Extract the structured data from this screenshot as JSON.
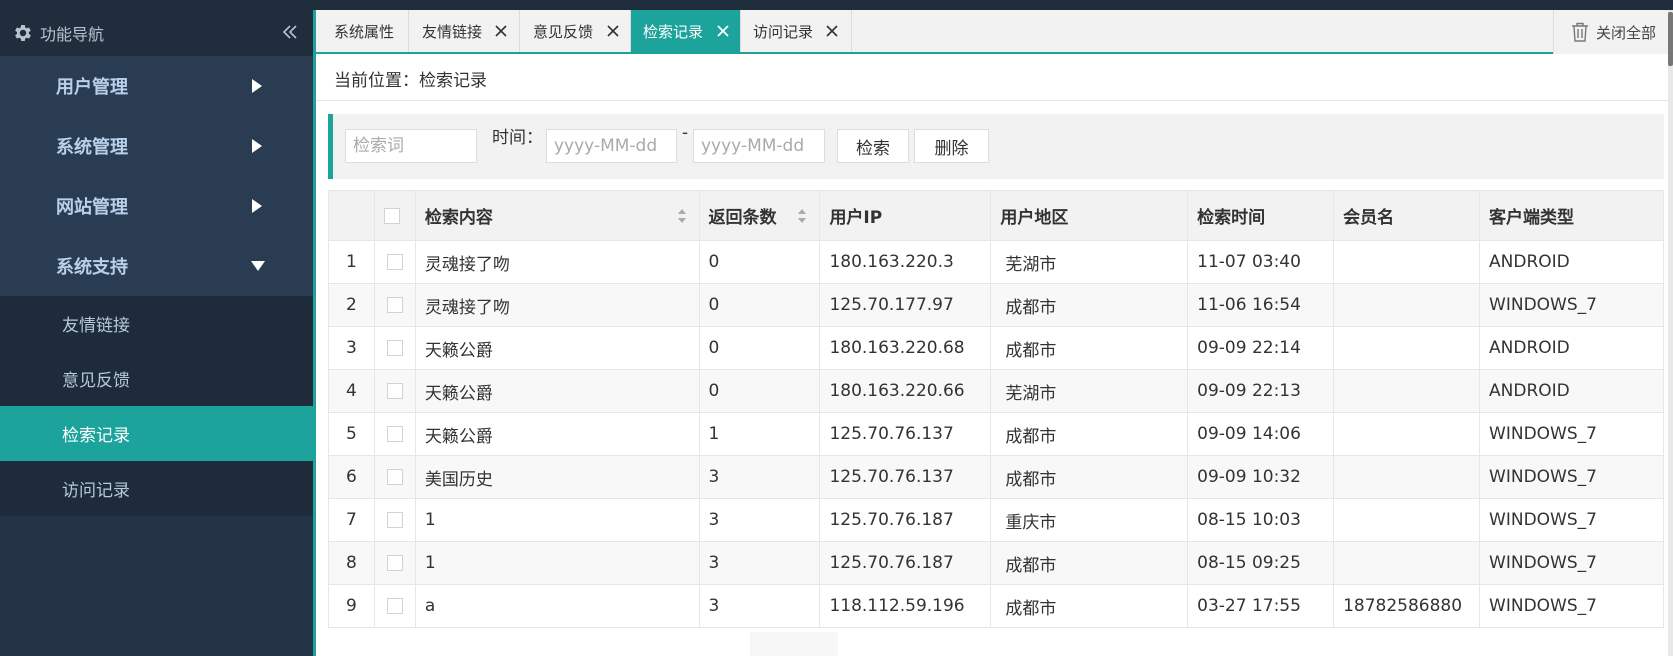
{
  "sidebar": {
    "title": "功能导航",
    "groups": [
      {
        "label": "用户管理"
      },
      {
        "label": "系统管理"
      },
      {
        "label": "网站管理"
      },
      {
        "label": "系统支持"
      }
    ],
    "sub_items": [
      {
        "label": "友情链接"
      },
      {
        "label": "意见反馈"
      },
      {
        "label": "检索记录"
      },
      {
        "label": "访问记录"
      }
    ]
  },
  "tabs": [
    {
      "label": "系统属性"
    },
    {
      "label": "友情链接"
    },
    {
      "label": "意见反馈"
    },
    {
      "label": "检索记录"
    },
    {
      "label": "访问记录"
    }
  ],
  "close_all_label": "关闭全部",
  "breadcrumb": "当前位置：检索记录",
  "search": {
    "keyword_placeholder": "检索词",
    "time_label": "时间：",
    "date_placeholder": "yyyy-MM-dd",
    "range_sep": "-",
    "search_button": "检索",
    "delete_button": "删除"
  },
  "table": {
    "headers": [
      "检索内容",
      "返回条数",
      "用户IP",
      "用户地区",
      "检索时间",
      "会员名",
      "客户端类型"
    ],
    "rows": [
      {
        "no": "1",
        "content": "灵魂接了吻",
        "count": "0",
        "ip": "180.163.220.3",
        "region": "芜湖市",
        "time": "11-07 03:40",
        "member": "",
        "client": "ANDROID"
      },
      {
        "no": "2",
        "content": "灵魂接了吻",
        "count": "0",
        "ip": "125.70.177.97",
        "region": "成都市",
        "time": "11-06 16:54",
        "member": "",
        "client": "WINDOWS_7"
      },
      {
        "no": "3",
        "content": "天籁公爵",
        "count": "0",
        "ip": "180.163.220.68",
        "region": "成都市",
        "time": "09-09 22:14",
        "member": "",
        "client": "ANDROID"
      },
      {
        "no": "4",
        "content": "天籁公爵",
        "count": "0",
        "ip": "180.163.220.66",
        "region": "芜湖市",
        "time": "09-09 22:13",
        "member": "",
        "client": "ANDROID"
      },
      {
        "no": "5",
        "content": "天籁公爵",
        "count": "1",
        "ip": "125.70.76.137",
        "region": "成都市",
        "time": "09-09 14:06",
        "member": "",
        "client": "WINDOWS_7"
      },
      {
        "no": "6",
        "content": "美国历史",
        "count": "3",
        "ip": "125.70.76.137",
        "region": "成都市",
        "time": "09-09 10:32",
        "member": "",
        "client": "WINDOWS_7"
      },
      {
        "no": "7",
        "content": "1",
        "count": "3",
        "ip": "125.70.76.187",
        "region": "重庆市",
        "time": "08-15 10:03",
        "member": "",
        "client": "WINDOWS_7"
      },
      {
        "no": "8",
        "content": "1",
        "count": "3",
        "ip": "125.70.76.187",
        "region": "成都市",
        "time": "08-15 09:25",
        "member": "",
        "client": "WINDOWS_7"
      },
      {
        "no": "9",
        "content": "a",
        "count": "3",
        "ip": "118.112.59.196",
        "region": "成都市",
        "time": "03-27 17:55",
        "member": "18782586880",
        "client": "WINDOWS_7"
      }
    ]
  },
  "colors": {
    "accent": "#1ba39c",
    "sidebar_bg": "#243446",
    "sidebar_dark": "#1f2d3d"
  }
}
